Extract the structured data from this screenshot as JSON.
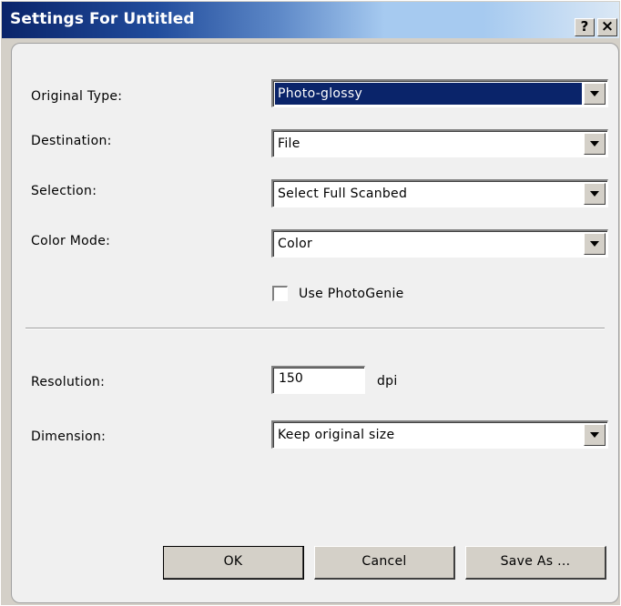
{
  "window": {
    "title": "Settings For Untitled",
    "help_label": "?",
    "close_label": "×"
  },
  "form": {
    "original_type": {
      "label": "Original Type:",
      "value": "Photo-glossy"
    },
    "destination": {
      "label": "Destination:",
      "value": "File"
    },
    "selection": {
      "label": "Selection:",
      "value": "Select Full Scanbed"
    },
    "color_mode": {
      "label": "Color Mode:",
      "value": "Color"
    },
    "use_photogenie": {
      "label": "Use PhotoGenie",
      "checked": false
    },
    "resolution": {
      "label": "Resolution:",
      "value": "150",
      "unit": "dpi"
    },
    "dimension": {
      "label": "Dimension:",
      "value": "Keep original size"
    }
  },
  "buttons": {
    "ok": "OK",
    "cancel": "Cancel",
    "save_as": "Save As ..."
  },
  "colors": {
    "title_bar_start": "#0a246a",
    "title_bar_end": "#a6caf0",
    "selection_highlight": "#0a246a",
    "dialog_background": "#d4d0c8"
  }
}
